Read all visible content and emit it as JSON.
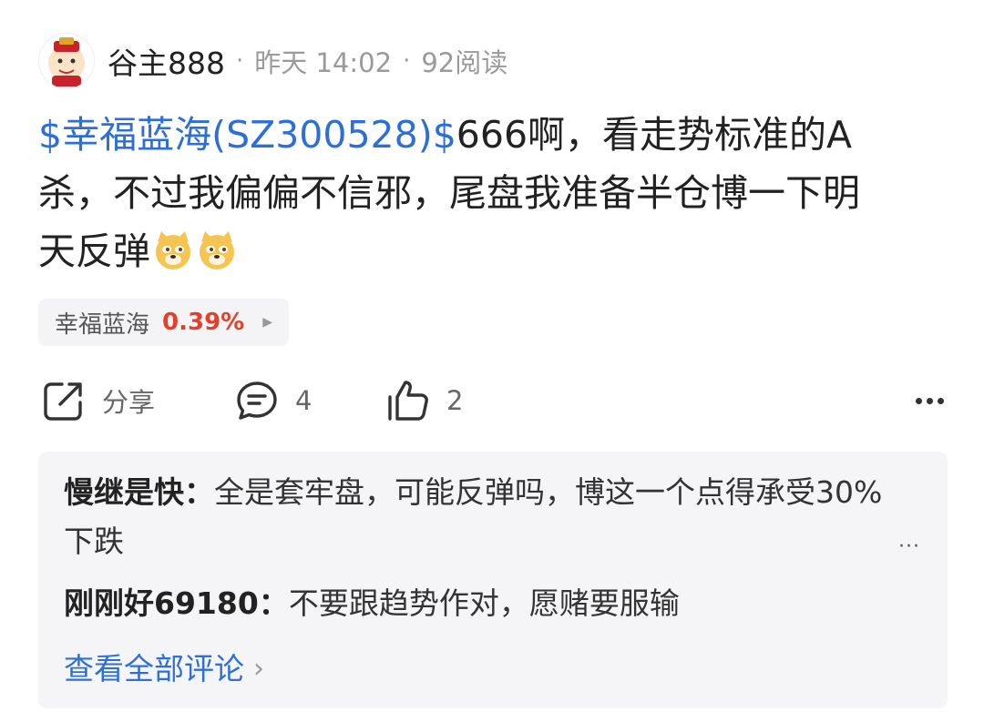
{
  "post": {
    "author": "谷主888",
    "time": "昨天 14:02",
    "reads": "92阅读",
    "stock_tag": "$幸福蓝海(SZ300528)$",
    "text_line1": "666啊，看走势标准的A",
    "text_line2": "杀，不过我偏偏不信邪，尾盘我准备半仓博一下明",
    "text_line3": "天反弹"
  },
  "stock_chip": {
    "name": "幸福蓝海",
    "change": "0.39%"
  },
  "actions": {
    "share_label": "分享",
    "comment_count": "4",
    "like_count": "2"
  },
  "comments": [
    {
      "user": "慢继是快：",
      "text": "全是套牢盘，可能反弹吗，博这一个点得承受30%下跌"
    },
    {
      "user": "刚刚好69180：",
      "text": "不要跟趋势作对，愿赌要服输"
    }
  ],
  "view_all_label": "查看全部评论",
  "colors": {
    "link_blue": "#2d6fd6",
    "gain_red": "#e2402c",
    "panel_bg": "#f5f5f7"
  },
  "icons": [
    "share-icon",
    "comment-icon",
    "like-icon",
    "more-icon",
    "doge-emoji"
  ]
}
